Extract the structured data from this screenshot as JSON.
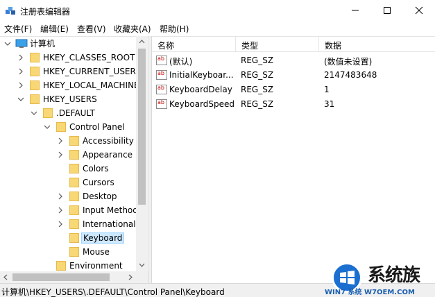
{
  "window": {
    "title": "注册表编辑器"
  },
  "menu": [
    "文件(F)",
    "编辑(E)",
    "查看(V)",
    "收藏夹(A)",
    "帮助(H)"
  ],
  "tree": {
    "root": "计算机",
    "items": [
      {
        "label": "HKEY_CLASSES_ROOT",
        "expanded": false
      },
      {
        "label": "HKEY_CURRENT_USER",
        "expanded": false
      },
      {
        "label": "HKEY_LOCAL_MACHINE",
        "expanded": false
      },
      {
        "label": "HKEY_USERS",
        "expanded": true
      },
      {
        "label": ".DEFAULT",
        "expanded": true
      },
      {
        "label": "Control Panel",
        "expanded": true
      },
      {
        "label": "Accessibility",
        "expanded": false
      },
      {
        "label": "Appearance",
        "expanded": false
      },
      {
        "label": "Colors",
        "expanded": null
      },
      {
        "label": "Cursors",
        "expanded": null
      },
      {
        "label": "Desktop",
        "expanded": false
      },
      {
        "label": "Input Method",
        "expanded": false
      },
      {
        "label": "International",
        "expanded": false
      },
      {
        "label": "Keyboard",
        "expanded": null,
        "selected": true
      },
      {
        "label": "Mouse",
        "expanded": null
      },
      {
        "label": "Environment",
        "expanded": null
      }
    ]
  },
  "list": {
    "columns": [
      "名称",
      "类型",
      "数据"
    ],
    "rows": [
      {
        "name": "(默认)",
        "type": "REG_SZ",
        "data": "(数值未设置)"
      },
      {
        "name": "InitialKeyboar...",
        "type": "REG_SZ",
        "data": "2147483648"
      },
      {
        "name": "KeyboardDelay",
        "type": "REG_SZ",
        "data": "1"
      },
      {
        "name": "KeyboardSpeed",
        "type": "REG_SZ",
        "data": "31"
      }
    ],
    "value_icon_text": "ab"
  },
  "status": {
    "path": "计算机\\HKEY_USERS\\.DEFAULT\\Control Panel\\Keyboard"
  },
  "watermark": {
    "cn": "系统族",
    "en": "WIN7 系统 W7OEM.COM"
  },
  "colors": {
    "folder": "#f8d775",
    "selection": "#cce8ff",
    "accent": "#1b6fd0"
  }
}
